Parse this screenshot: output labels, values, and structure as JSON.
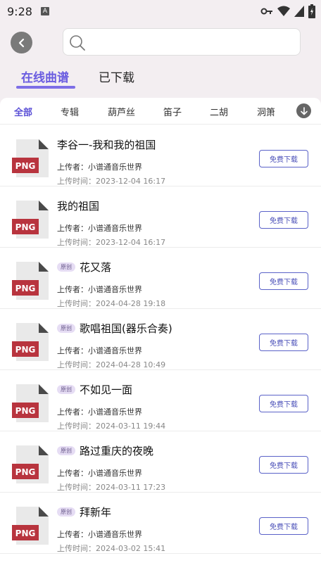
{
  "status": {
    "time": "9:28",
    "notif": "A"
  },
  "search": {
    "placeholder": ""
  },
  "tabs": {
    "online": "在线曲谱",
    "downloaded": "已下载"
  },
  "categories": [
    "全部",
    "专辑",
    "葫芦丝",
    "笛子",
    "二胡",
    "洞箫"
  ],
  "file_label": "PNG",
  "download_label": "免费下载",
  "badge_label": "原创",
  "items": [
    {
      "title": "李谷一-我和我的祖国",
      "original": false,
      "uploader": "上传者：小谱通音乐世界",
      "time": "上传时间：2023-12-04 16:17"
    },
    {
      "title": "我的祖国",
      "original": false,
      "uploader": "上传者：小谱通音乐世界",
      "time": "上传时间：2023-12-04 16:17"
    },
    {
      "title": "花又落",
      "original": true,
      "uploader": "上传者：小谱通音乐世界",
      "time": "上传时间：2024-04-28 19:18"
    },
    {
      "title": "歌唱祖国(器乐合奏)",
      "original": true,
      "uploader": "上传者：小谱通音乐世界",
      "time": "上传时间：2024-04-28 10:49"
    },
    {
      "title": "不如见一面",
      "original": true,
      "uploader": "上传者：小谱通音乐世界",
      "time": "上传时间：2024-03-11 19:44"
    },
    {
      "title": "路过重庆的夜晚",
      "original": true,
      "uploader": "上传者：小谱通音乐世界",
      "time": "上传时间：2024-03-11 17:23"
    },
    {
      "title": "拜新年",
      "original": true,
      "uploader": "上传者：小谱通音乐世界",
      "time": "上传时间：2024-03-02 15:41"
    }
  ],
  "colors": {
    "accent": "#6a5ce0",
    "file_red": "#b8343e",
    "background": "#f3eef1"
  }
}
